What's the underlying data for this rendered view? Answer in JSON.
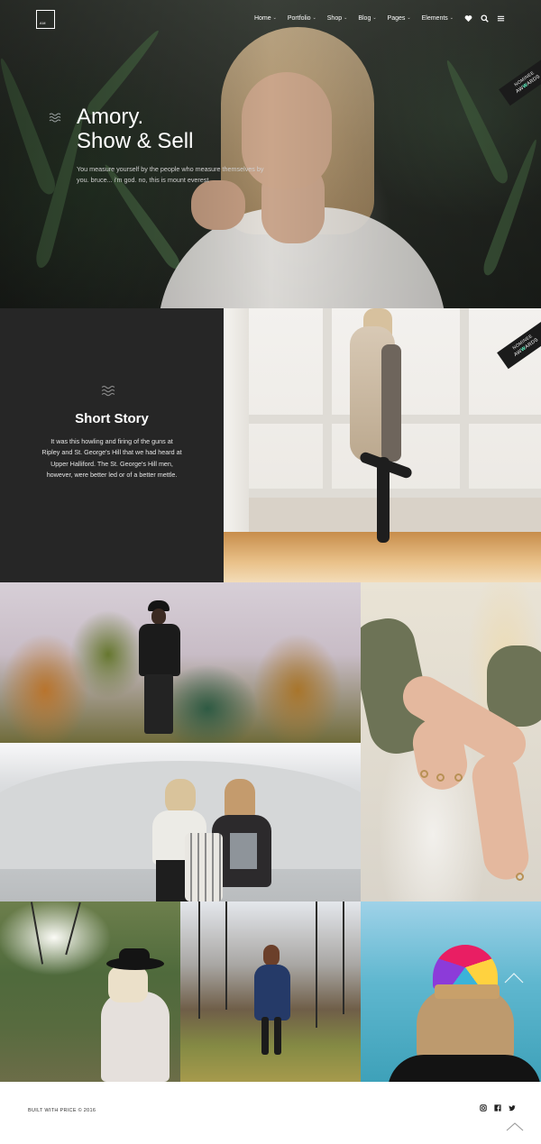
{
  "header": {
    "logo_text": "AM",
    "nav": [
      {
        "label": "Home",
        "has_submenu": true
      },
      {
        "label": "Portfolio",
        "has_submenu": true
      },
      {
        "label": "Shop",
        "has_submenu": true
      },
      {
        "label": "Blog",
        "has_submenu": true
      },
      {
        "label": "Pages",
        "has_submenu": true
      },
      {
        "label": "Elements",
        "has_submenu": true
      }
    ],
    "icons": [
      "heart-icon",
      "search-icon",
      "menu-icon"
    ],
    "submenu_glyph": "⌄"
  },
  "hero": {
    "title_line1": "Amory.",
    "title_line2": "Show & Sell",
    "text": "You measure yourself by the people who measure themselves by you. bruce... i'm god. no, this is mount everest"
  },
  "award": {
    "top": "NOMINEE",
    "bottom_prefix": "AW",
    "bottom_accent": "W",
    "bottom_suffix": "ARDS"
  },
  "story": {
    "title": "Short Story",
    "text": "It was this howling and firing of the guns at Ripley and St. George's Hill that we had heard at Upper Halliford. The St. George's Hill men, however, were better led or of a better mettle."
  },
  "footer": {
    "copyright": "BUILT WITH PRICE © 2016",
    "social": [
      "instagram-icon",
      "facebook-icon",
      "twitter-icon"
    ]
  },
  "colors": {
    "story_bg": "#262626",
    "award_bg": "#1b1b1b",
    "award_accent": "#66ffcc"
  }
}
